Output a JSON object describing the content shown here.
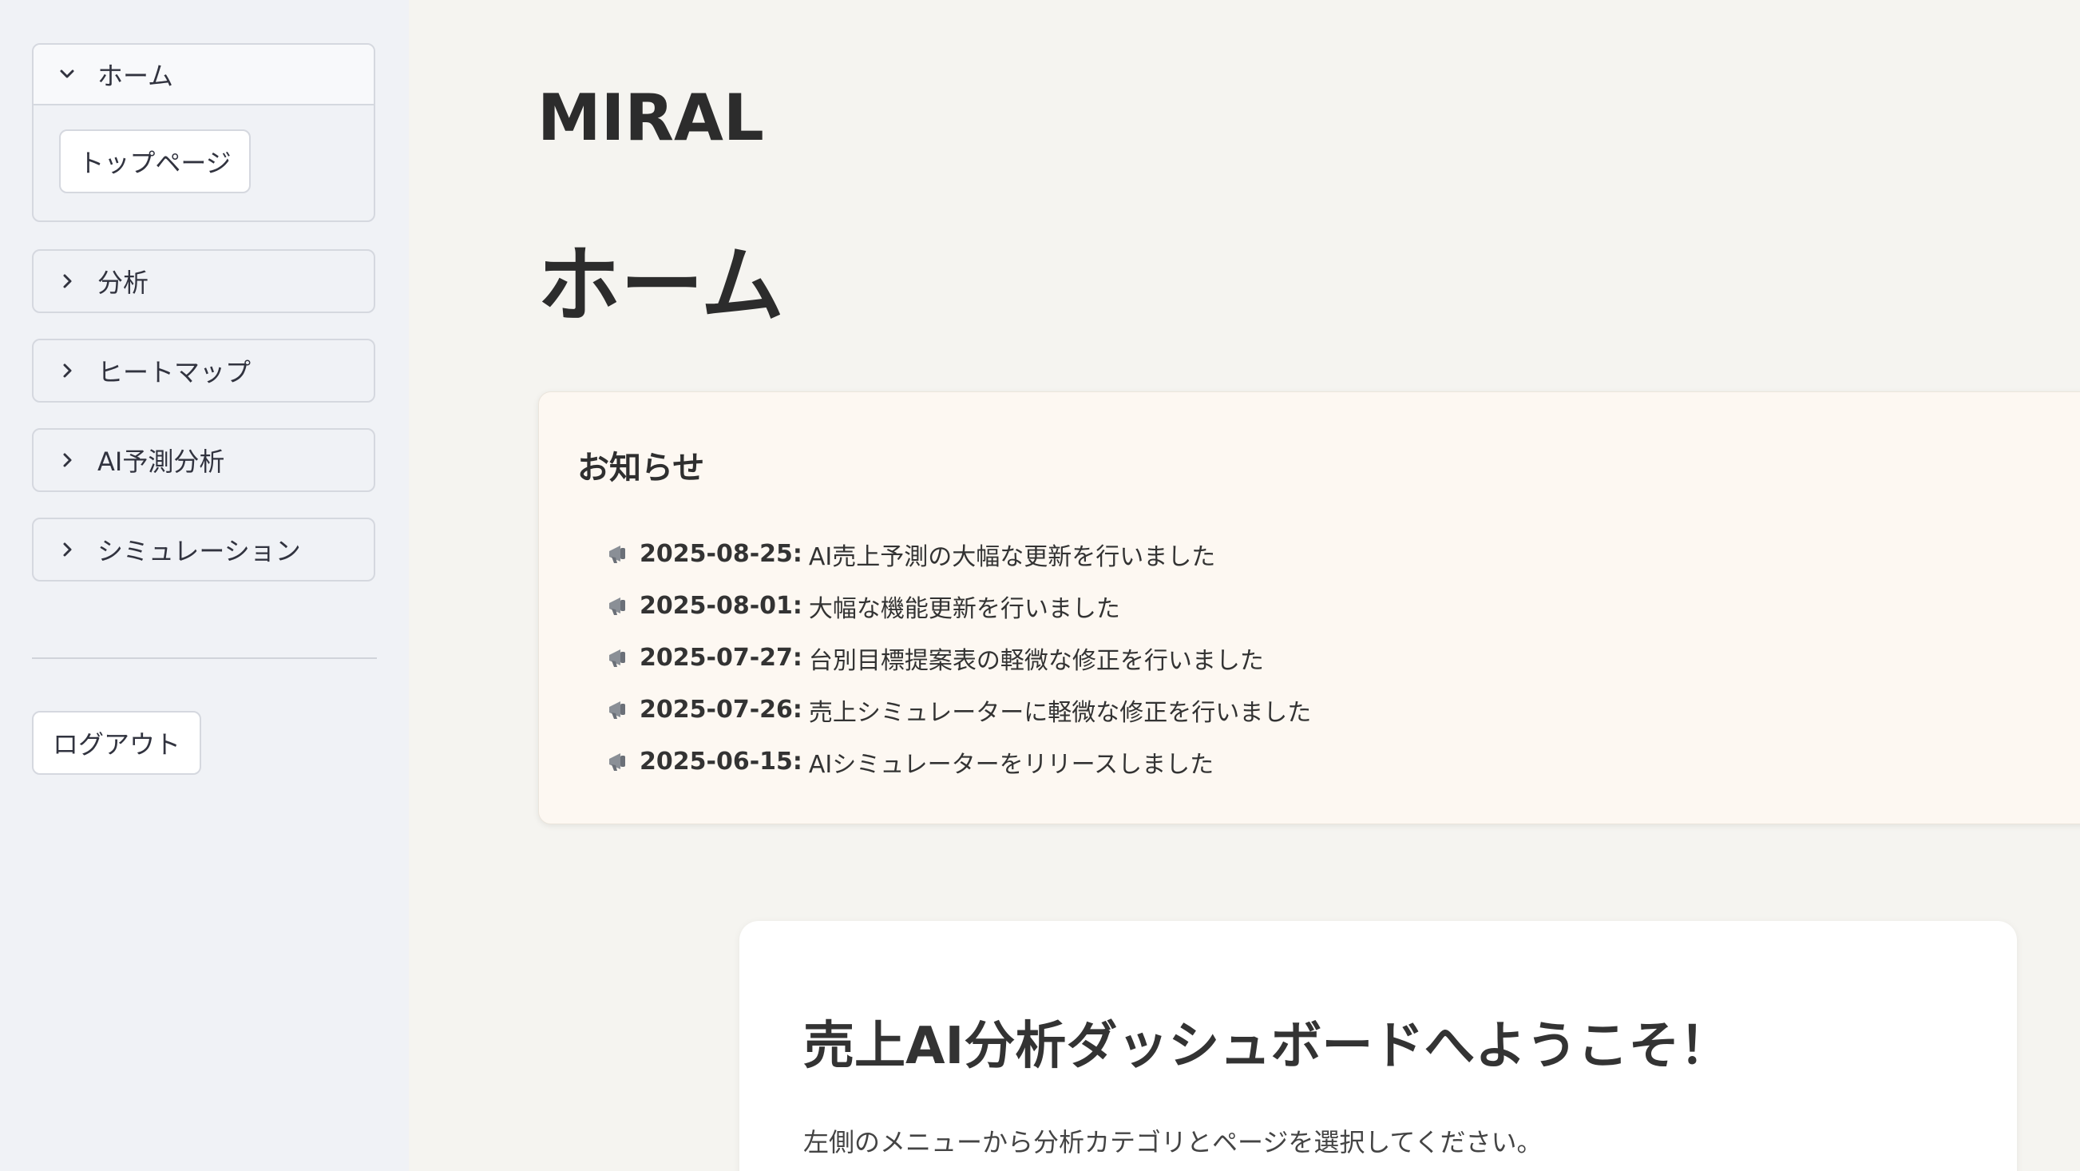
{
  "sidebar": {
    "menu": [
      {
        "label": "ホーム",
        "expanded": true,
        "buttons": [
          "トップページ"
        ]
      },
      {
        "label": "分析",
        "expanded": false
      },
      {
        "label": "ヒートマップ",
        "expanded": false
      },
      {
        "label": "AI予測分析",
        "expanded": false
      },
      {
        "label": "シミュレーション",
        "expanded": false
      }
    ],
    "logout_label": "ログアウト"
  },
  "main": {
    "app_title": "MIRAL",
    "page_title": "ホーム",
    "notices": {
      "title": "お知らせ",
      "icon": "megaphone-icon",
      "items": [
        {
          "date": "2025-08-25:",
          "text": "AI売上予測の大幅な更新を行いました"
        },
        {
          "date": "2025-08-01:",
          "text": "大幅な機能更新を行いました"
        },
        {
          "date": "2025-07-27:",
          "text": "台別目標提案表の軽微な修正を行いました"
        },
        {
          "date": "2025-07-26:",
          "text": "売上シミュレーターに軽微な修正を行いました"
        },
        {
          "date": "2025-06-15:",
          "text": "AIシミュレーターをリリースしました"
        }
      ]
    },
    "welcome": {
      "title": "売上AI分析ダッシュボードへようこそ！",
      "text": "左側のメニューから分析カテゴリとページを選択してください。"
    }
  },
  "colors": {
    "sidebar_bg": "#f0f2f6",
    "main_bg": "#f5f4f0",
    "notice_bg": "#fdf8f2",
    "text": "#31333f"
  }
}
